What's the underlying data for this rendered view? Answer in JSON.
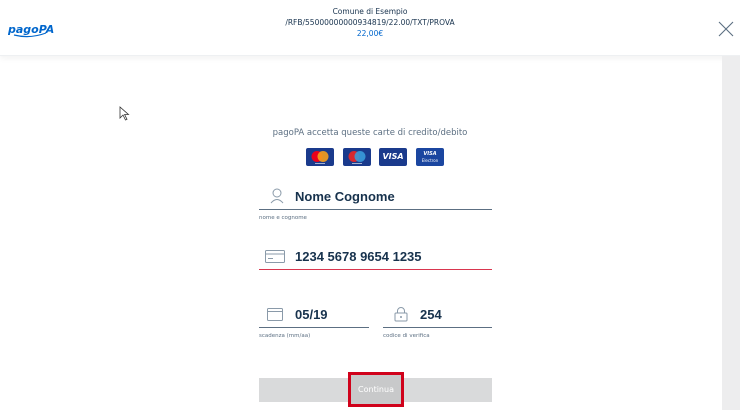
{
  "header": {
    "logo_text": "pagoPA",
    "organization": "Comune di Esempio",
    "payment_reference": "/RFB/55000000000934819/22.00/TXT/PROVA",
    "amount": "22,00€"
  },
  "form": {
    "accepted_cards_text": "pagoPA accetta queste carte di credito/debito",
    "accepted_cards": [
      "mastercard",
      "maestro",
      "VISA",
      "VISA Electron"
    ],
    "visa_label": "VISA",
    "visa_electron_top": "VISA",
    "visa_electron_bottom": "Electron",
    "name": {
      "value": "Nome Cognome",
      "label": "nome e cognome",
      "icon": "user-icon"
    },
    "card_number": {
      "value": "1234 5678 9654 1235",
      "icon": "credit-card-icon",
      "status": "error"
    },
    "expiry": {
      "value": "05/19",
      "label": "scadenza (mm/aa)",
      "icon": "calendar-icon"
    },
    "cvv": {
      "value": "254",
      "label": "codice di verifica",
      "icon": "lock-icon"
    },
    "continue_label": "Continua"
  },
  "colors": {
    "brand_blue": "#0066cc",
    "text": "#17324d",
    "error_underline": "#d9364f",
    "highlight_box": "#d0021b"
  }
}
